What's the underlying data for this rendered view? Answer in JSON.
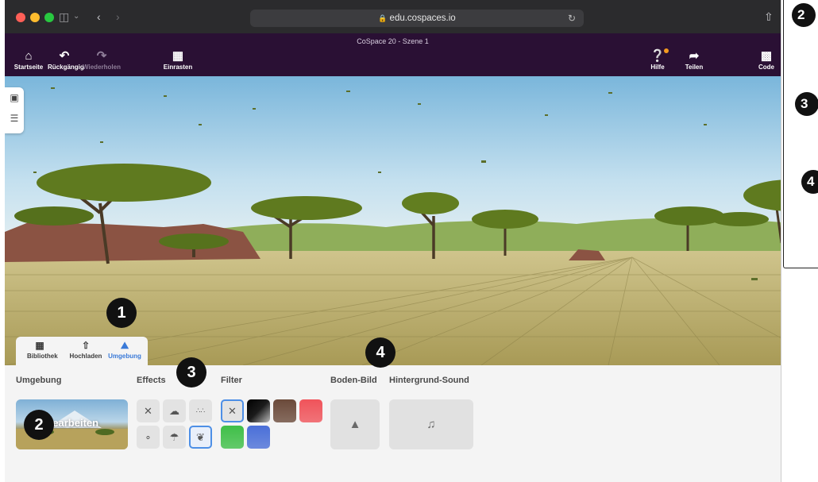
{
  "browser": {
    "url": "edu.cospaces.io"
  },
  "header": {
    "scene_title": "CoSpace 20 - Szene 1",
    "buttons": {
      "home": "Startseite",
      "undo": "Rückgängig",
      "redo": "Wiederholen",
      "snap": "Einrasten",
      "help": "Hilfe",
      "share": "Teilen",
      "code": "Code"
    }
  },
  "tabs": [
    {
      "label": "Bibliothek",
      "icon": "library-icon"
    },
    {
      "label": "Hochladen",
      "icon": "upload-icon"
    },
    {
      "label": "Umgebung",
      "icon": "environment-icon",
      "active": true
    }
  ],
  "panel": {
    "environment_title": "Umgebung",
    "environment_edit_label": "Bearbeiten",
    "effects_title": "Effects",
    "filter_title": "Filter",
    "ground_title": "Boden-Bild",
    "sound_title": "Hintergrund-Sound",
    "filter_colors": [
      "#1c1c1c",
      "#6b4a3a",
      "#f0535a",
      "#3fbf48",
      "#4a6fd8"
    ]
  },
  "callouts": [
    "1",
    "2",
    "3",
    "4"
  ],
  "right_callouts": [
    "2",
    "3",
    "4"
  ]
}
